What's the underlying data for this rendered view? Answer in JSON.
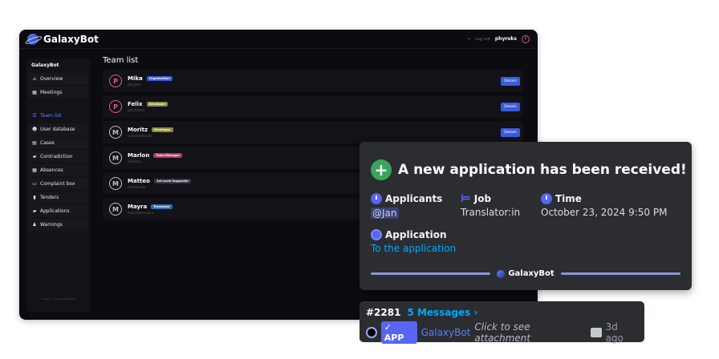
{
  "app": {
    "name": "GalaxyBot"
  },
  "topbar": {
    "logout": "Log out",
    "username": "phyroks",
    "avatar_letter": "P"
  },
  "sidebar": {
    "title": "GalaxyBot",
    "items": [
      {
        "label": "Overview",
        "icon": "home-icon"
      },
      {
        "label": "Meetings",
        "icon": "calendar-icon"
      },
      {
        "label": "Team list",
        "icon": "list-icon",
        "active": true
      },
      {
        "label": "User database",
        "icon": "users-icon"
      },
      {
        "label": "Cases",
        "icon": "cases-icon"
      },
      {
        "label": "Contradiction",
        "icon": "folder-icon"
      },
      {
        "label": "Absences",
        "icon": "calendar-icon"
      },
      {
        "label": "Complaint box",
        "icon": "inbox-icon"
      },
      {
        "label": "Tenders",
        "icon": "bookmark-icon"
      },
      {
        "label": "Applications",
        "icon": "folder-icon"
      },
      {
        "label": "Warnings",
        "icon": "user-warning-icon"
      }
    ],
    "footer": "Imprint · Data protection"
  },
  "main": {
    "title": "Team list",
    "details_label": "Details",
    "members": [
      {
        "name": "Mika",
        "handle": "phyroks",
        "badge": "Organisation",
        "badge_color": "#3b5bdb",
        "letter": "P"
      },
      {
        "name": "Felix",
        "handle": "penddevel",
        "badge": "Developer",
        "badge_color": "#8a8a3a",
        "letter": "P"
      },
      {
        "name": "Moritz",
        "handle": "unrechtemoritz",
        "badge": "Developer",
        "badge_color": "#8a8a3a",
        "letter": "M"
      },
      {
        "name": "Marlon",
        "handle": "marl0nx",
        "badge": "Team-Manager",
        "badge_color": "#b03a6a",
        "letter": "M"
      },
      {
        "name": "Matteo",
        "handle": "matteo.ww",
        "badge": "1st Level Supporter",
        "badge_color": "#3a3a46",
        "letter": "M"
      },
      {
        "name": "Mayra",
        "handle": "heyichbinmayra",
        "badge": "Translator",
        "badge_color": "#2f6fae",
        "letter": "M"
      }
    ]
  },
  "embed": {
    "title": "A new application has been received!",
    "fields": {
      "applicants": {
        "label": "Applicants",
        "value": "@Jan"
      },
      "job": {
        "label": "Job",
        "value": "Translator:in"
      },
      "time": {
        "label": "Time",
        "value": "October 23, 2024 9:50 PM"
      },
      "application": {
        "label": "Application",
        "value": "To the application"
      }
    },
    "footer": "GalaxyBot"
  },
  "thread": {
    "id": "#2281",
    "messages": "5 Messages ›",
    "app_tag": "✓ APP",
    "bot": "GalaxyBot",
    "attachment": "Click to see attachment",
    "ago": "3d ago"
  }
}
